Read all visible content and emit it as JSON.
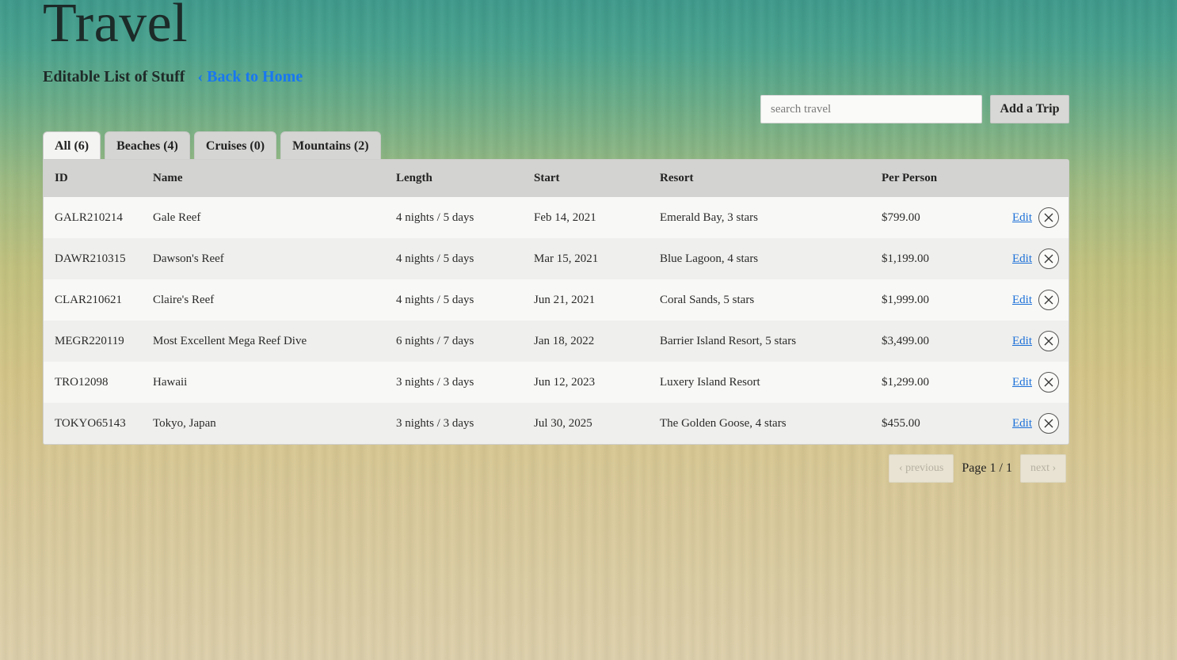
{
  "header": {
    "title": "Travel",
    "subtitle": "Editable List of Stuff",
    "back_link": "‹ Back to Home"
  },
  "toolbar": {
    "search_placeholder": "search travel",
    "search_value": "",
    "add_label": "Add a Trip"
  },
  "tabs": [
    {
      "label": "All (6)",
      "active": true
    },
    {
      "label": "Beaches (4)",
      "active": false
    },
    {
      "label": "Cruises (0)",
      "active": false
    },
    {
      "label": "Mountains (2)",
      "active": false
    }
  ],
  "table": {
    "columns": [
      "ID",
      "Name",
      "Length",
      "Start",
      "Resort",
      "Per Person"
    ],
    "edit_label": "Edit",
    "rows": [
      {
        "id": "GALR210214",
        "name": "Gale Reef",
        "length": "4 nights / 5 days",
        "start": "Feb 14, 2021",
        "resort": "Emerald Bay, 3 stars",
        "price": "$799.00"
      },
      {
        "id": "DAWR210315",
        "name": "Dawson's Reef",
        "length": "4 nights / 5 days",
        "start": "Mar 15, 2021",
        "resort": "Blue Lagoon, 4 stars",
        "price": "$1,199.00"
      },
      {
        "id": "CLAR210621",
        "name": "Claire's Reef",
        "length": "4 nights / 5 days",
        "start": "Jun 21, 2021",
        "resort": "Coral Sands, 5 stars",
        "price": "$1,999.00"
      },
      {
        "id": "MEGR220119",
        "name": "Most Excellent Mega Reef Dive",
        "length": "6 nights / 7 days",
        "start": "Jan 18, 2022",
        "resort": "Barrier Island Resort, 5 stars",
        "price": "$3,499.00"
      },
      {
        "id": "TRO12098",
        "name": "Hawaii",
        "length": "3 nights / 3 days",
        "start": "Jun 12, 2023",
        "resort": "Luxery Island Resort",
        "price": "$1,299.00"
      },
      {
        "id": "TOKYO65143",
        "name": "Tokyo, Japan",
        "length": "3 nights / 3 days",
        "start": "Jul 30, 2025",
        "resort": "The Golden Goose, 4 stars",
        "price": "$455.00"
      }
    ]
  },
  "pagination": {
    "previous_label": "‹ previous",
    "page_text": "Page 1 / 1",
    "next_label": "next ›"
  }
}
